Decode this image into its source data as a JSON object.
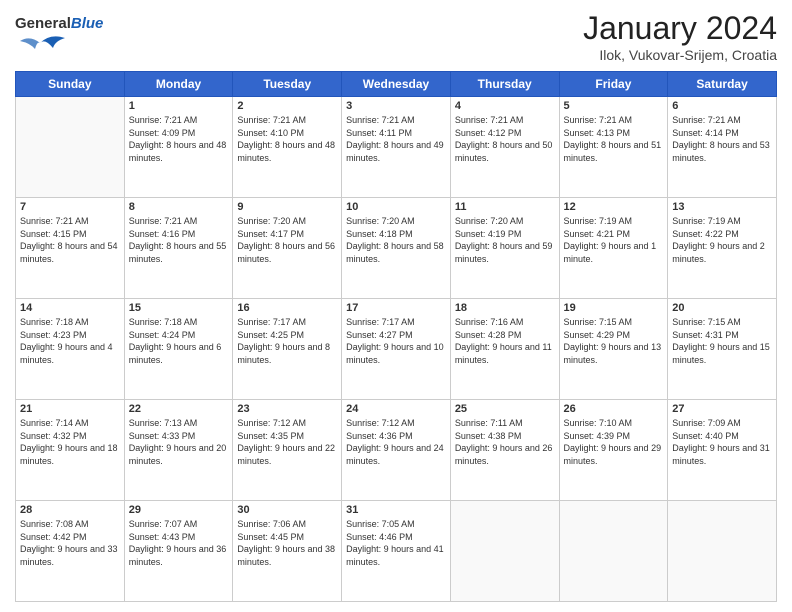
{
  "header": {
    "logo": {
      "general": "General",
      "blue": "Blue"
    },
    "title": "January 2024",
    "subtitle": "Ilok, Vukovar-Srijem, Croatia"
  },
  "days_of_week": [
    "Sunday",
    "Monday",
    "Tuesday",
    "Wednesday",
    "Thursday",
    "Friday",
    "Saturday"
  ],
  "weeks": [
    [
      {
        "day": null,
        "num": "",
        "sunrise": "",
        "sunset": "",
        "daylight": ""
      },
      {
        "day": 1,
        "num": "1",
        "sunrise": "7:21 AM",
        "sunset": "4:09 PM",
        "daylight": "8 hours and 48 minutes."
      },
      {
        "day": 2,
        "num": "2",
        "sunrise": "7:21 AM",
        "sunset": "4:10 PM",
        "daylight": "8 hours and 48 minutes."
      },
      {
        "day": 3,
        "num": "3",
        "sunrise": "7:21 AM",
        "sunset": "4:11 PM",
        "daylight": "8 hours and 49 minutes."
      },
      {
        "day": 4,
        "num": "4",
        "sunrise": "7:21 AM",
        "sunset": "4:12 PM",
        "daylight": "8 hours and 50 minutes."
      },
      {
        "day": 5,
        "num": "5",
        "sunrise": "7:21 AM",
        "sunset": "4:13 PM",
        "daylight": "8 hours and 51 minutes."
      },
      {
        "day": 6,
        "num": "6",
        "sunrise": "7:21 AM",
        "sunset": "4:14 PM",
        "daylight": "8 hours and 53 minutes."
      }
    ],
    [
      {
        "day": 7,
        "num": "7",
        "sunrise": "7:21 AM",
        "sunset": "4:15 PM",
        "daylight": "8 hours and 54 minutes."
      },
      {
        "day": 8,
        "num": "8",
        "sunrise": "7:21 AM",
        "sunset": "4:16 PM",
        "daylight": "8 hours and 55 minutes."
      },
      {
        "day": 9,
        "num": "9",
        "sunrise": "7:20 AM",
        "sunset": "4:17 PM",
        "daylight": "8 hours and 56 minutes."
      },
      {
        "day": 10,
        "num": "10",
        "sunrise": "7:20 AM",
        "sunset": "4:18 PM",
        "daylight": "8 hours and 58 minutes."
      },
      {
        "day": 11,
        "num": "11",
        "sunrise": "7:20 AM",
        "sunset": "4:19 PM",
        "daylight": "8 hours and 59 minutes."
      },
      {
        "day": 12,
        "num": "12",
        "sunrise": "7:19 AM",
        "sunset": "4:21 PM",
        "daylight": "9 hours and 1 minute."
      },
      {
        "day": 13,
        "num": "13",
        "sunrise": "7:19 AM",
        "sunset": "4:22 PM",
        "daylight": "9 hours and 2 minutes."
      }
    ],
    [
      {
        "day": 14,
        "num": "14",
        "sunrise": "7:18 AM",
        "sunset": "4:23 PM",
        "daylight": "9 hours and 4 minutes."
      },
      {
        "day": 15,
        "num": "15",
        "sunrise": "7:18 AM",
        "sunset": "4:24 PM",
        "daylight": "9 hours and 6 minutes."
      },
      {
        "day": 16,
        "num": "16",
        "sunrise": "7:17 AM",
        "sunset": "4:25 PM",
        "daylight": "9 hours and 8 minutes."
      },
      {
        "day": 17,
        "num": "17",
        "sunrise": "7:17 AM",
        "sunset": "4:27 PM",
        "daylight": "9 hours and 10 minutes."
      },
      {
        "day": 18,
        "num": "18",
        "sunrise": "7:16 AM",
        "sunset": "4:28 PM",
        "daylight": "9 hours and 11 minutes."
      },
      {
        "day": 19,
        "num": "19",
        "sunrise": "7:15 AM",
        "sunset": "4:29 PM",
        "daylight": "9 hours and 13 minutes."
      },
      {
        "day": 20,
        "num": "20",
        "sunrise": "7:15 AM",
        "sunset": "4:31 PM",
        "daylight": "9 hours and 15 minutes."
      }
    ],
    [
      {
        "day": 21,
        "num": "21",
        "sunrise": "7:14 AM",
        "sunset": "4:32 PM",
        "daylight": "9 hours and 18 minutes."
      },
      {
        "day": 22,
        "num": "22",
        "sunrise": "7:13 AM",
        "sunset": "4:33 PM",
        "daylight": "9 hours and 20 minutes."
      },
      {
        "day": 23,
        "num": "23",
        "sunrise": "7:12 AM",
        "sunset": "4:35 PM",
        "daylight": "9 hours and 22 minutes."
      },
      {
        "day": 24,
        "num": "24",
        "sunrise": "7:12 AM",
        "sunset": "4:36 PM",
        "daylight": "9 hours and 24 minutes."
      },
      {
        "day": 25,
        "num": "25",
        "sunrise": "7:11 AM",
        "sunset": "4:38 PM",
        "daylight": "9 hours and 26 minutes."
      },
      {
        "day": 26,
        "num": "26",
        "sunrise": "7:10 AM",
        "sunset": "4:39 PM",
        "daylight": "9 hours and 29 minutes."
      },
      {
        "day": 27,
        "num": "27",
        "sunrise": "7:09 AM",
        "sunset": "4:40 PM",
        "daylight": "9 hours and 31 minutes."
      }
    ],
    [
      {
        "day": 28,
        "num": "28",
        "sunrise": "7:08 AM",
        "sunset": "4:42 PM",
        "daylight": "9 hours and 33 minutes."
      },
      {
        "day": 29,
        "num": "29",
        "sunrise": "7:07 AM",
        "sunset": "4:43 PM",
        "daylight": "9 hours and 36 minutes."
      },
      {
        "day": 30,
        "num": "30",
        "sunrise": "7:06 AM",
        "sunset": "4:45 PM",
        "daylight": "9 hours and 38 minutes."
      },
      {
        "day": 31,
        "num": "31",
        "sunrise": "7:05 AM",
        "sunset": "4:46 PM",
        "daylight": "9 hours and 41 minutes."
      },
      {
        "day": null,
        "num": "",
        "sunrise": "",
        "sunset": "",
        "daylight": ""
      },
      {
        "day": null,
        "num": "",
        "sunrise": "",
        "sunset": "",
        "daylight": ""
      },
      {
        "day": null,
        "num": "",
        "sunrise": "",
        "sunset": "",
        "daylight": ""
      }
    ]
  ]
}
